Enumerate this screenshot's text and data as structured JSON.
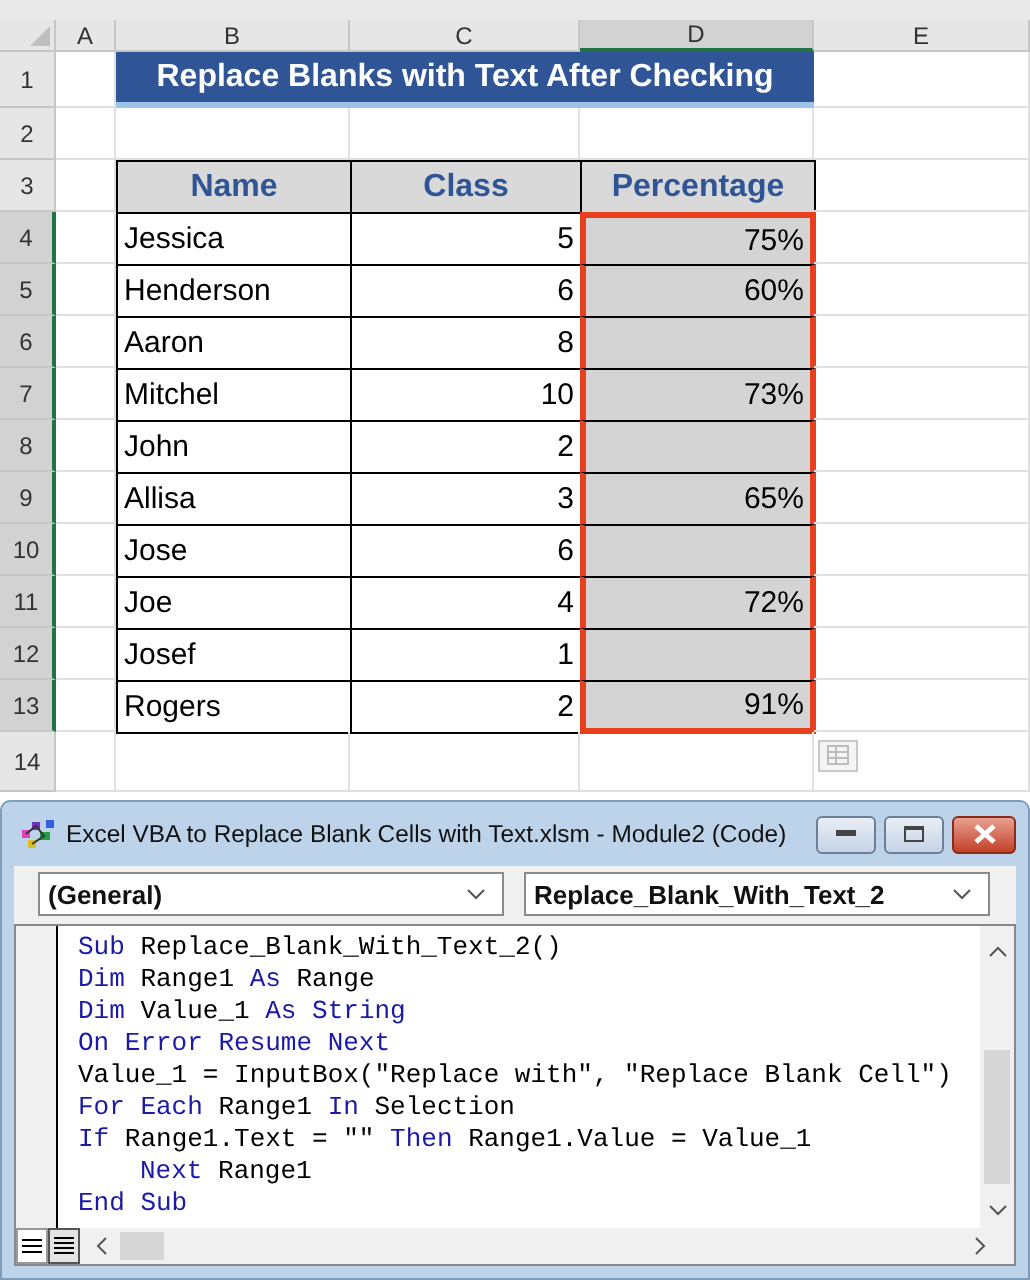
{
  "sheet": {
    "columns": [
      {
        "label": "A",
        "selected": false
      },
      {
        "label": "B",
        "selected": false
      },
      {
        "label": "C",
        "selected": false
      },
      {
        "label": "D",
        "selected": true
      },
      {
        "label": "E",
        "selected": false
      }
    ],
    "title_row": {
      "row": "1",
      "text": "Replace Blanks with Text After Checking"
    },
    "blank_rows": [
      "2"
    ],
    "header": {
      "row": "3",
      "cells": [
        "Name",
        "Class",
        "Percentage"
      ]
    },
    "rows": [
      {
        "row": "4",
        "name": "Jessica",
        "class": "5",
        "percentage": "75%",
        "selected": true
      },
      {
        "row": "5",
        "name": "Henderson",
        "class": "6",
        "percentage": "60%",
        "selected": true
      },
      {
        "row": "6",
        "name": "Aaron",
        "class": "8",
        "percentage": "",
        "selected": true
      },
      {
        "row": "7",
        "name": "Mitchel",
        "class": "10",
        "percentage": "73%",
        "selected": true
      },
      {
        "row": "8",
        "name": "John",
        "class": "2",
        "percentage": "",
        "selected": true
      },
      {
        "row": "9",
        "name": "Allisa",
        "class": "3",
        "percentage": "65%",
        "selected": true
      },
      {
        "row": "10",
        "name": "Jose",
        "class": "6",
        "percentage": "",
        "selected": true
      },
      {
        "row": "11",
        "name": "Joe",
        "class": "4",
        "percentage": "72%",
        "selected": true
      },
      {
        "row": "12",
        "name": "Josef",
        "class": "1",
        "percentage": "",
        "selected": true
      },
      {
        "row": "13",
        "name": "Rogers",
        "class": "2",
        "percentage": "91%",
        "selected": true
      }
    ],
    "trailing_rows": [
      "14"
    ]
  },
  "vba_window": {
    "title": "Excel VBA to Replace Blank Cells with Text.xlsm - Module2 (Code)",
    "object_dropdown": "(General)",
    "procedure_dropdown": "Replace_Blank_With_Text_2",
    "code_lines": [
      {
        "indented": false,
        "tokens": [
          {
            "text": "Sub",
            "kind": "keyword"
          },
          {
            "text": " Replace_Blank_With_Text_2()",
            "kind": "plain"
          }
        ]
      },
      {
        "indented": false,
        "tokens": [
          {
            "text": "Dim",
            "kind": "keyword"
          },
          {
            "text": " Range1 ",
            "kind": "plain"
          },
          {
            "text": "As",
            "kind": "keyword"
          },
          {
            "text": " Range",
            "kind": "plain"
          }
        ]
      },
      {
        "indented": false,
        "tokens": [
          {
            "text": "Dim",
            "kind": "keyword"
          },
          {
            "text": " Value_1 ",
            "kind": "plain"
          },
          {
            "text": "As",
            "kind": "keyword"
          },
          {
            "text": " String",
            "kind": "keyword"
          }
        ]
      },
      {
        "indented": false,
        "tokens": [
          {
            "text": "On Error Resume Next",
            "kind": "keyword"
          }
        ]
      },
      {
        "indented": false,
        "tokens": [
          {
            "text": "Value_1 = InputBox(\"Replace with\", \"Replace Blank Cell\")",
            "kind": "plain"
          }
        ]
      },
      {
        "indented": false,
        "tokens": [
          {
            "text": "For Each",
            "kind": "keyword"
          },
          {
            "text": " Range1 ",
            "kind": "plain"
          },
          {
            "text": "In",
            "kind": "keyword"
          },
          {
            "text": " Selection",
            "kind": "plain"
          }
        ]
      },
      {
        "indented": false,
        "tokens": [
          {
            "text": "If",
            "kind": "keyword"
          },
          {
            "text": " Range1.Text = \"\" ",
            "kind": "plain"
          },
          {
            "text": "Then",
            "kind": "keyword"
          },
          {
            "text": " Range1.Value = Value_1",
            "kind": "plain"
          }
        ]
      },
      {
        "indented": true,
        "tokens": [
          {
            "text": "Next",
            "kind": "keyword"
          },
          {
            "text": " Range1",
            "kind": "plain"
          }
        ]
      },
      {
        "indented": false,
        "tokens": [
          {
            "text": "End Sub",
            "kind": "keyword"
          }
        ]
      }
    ]
  }
}
